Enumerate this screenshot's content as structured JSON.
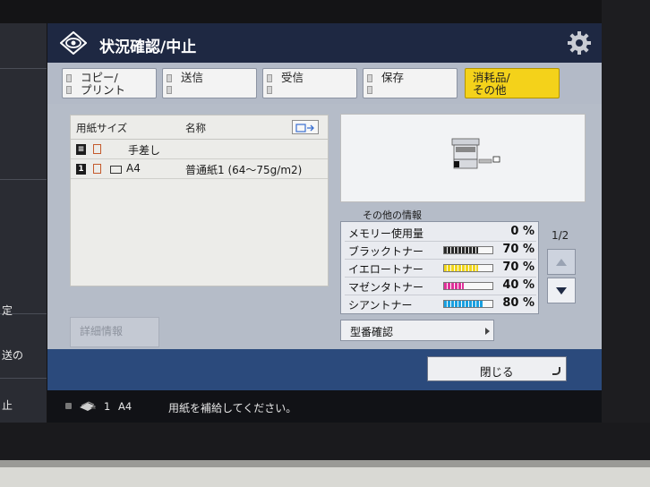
{
  "header": {
    "title": "状況確認/中止",
    "logo_icon": "eye-diamond-icon",
    "settings_icon": "gear-icon"
  },
  "tabs": [
    {
      "label": "コピー/\nプリント",
      "active": false
    },
    {
      "label": "送信",
      "active": false
    },
    {
      "label": "受信",
      "active": false
    },
    {
      "label": "保存",
      "active": false
    },
    {
      "label": "消耗品/\nその他",
      "active": true
    }
  ],
  "paper": {
    "columns": {
      "size": "用紙サイズ",
      "name": "名称"
    },
    "rows": [
      {
        "slot": "",
        "size": "",
        "name": "手差し"
      },
      {
        "slot": "1",
        "size": "A4",
        "name": "普通紙1 (64〜75g/m2)"
      }
    ]
  },
  "detail_button": "詳細情報",
  "other_info": {
    "label": "その他の情報",
    "rows": [
      {
        "label": "メモリー使用量",
        "percent": "0 %",
        "color": "",
        "level": 0
      },
      {
        "label": "ブラックトナー",
        "percent": "70 %",
        "color": "#2a2a2a",
        "level": 70
      },
      {
        "label": "イエロートナー",
        "percent": "70 %",
        "color": "#f0d61c",
        "level": 70
      },
      {
        "label": "マゼンタトナー",
        "percent": "40 %",
        "color": "#e0309a",
        "level": 40
      },
      {
        "label": "シアントナー",
        "percent": "80 %",
        "color": "#1aa0e0",
        "level": 80
      }
    ],
    "page": "1/2"
  },
  "model_button": "型番確認",
  "close_button": "閉じる",
  "status": {
    "tray": "1",
    "size": "A4",
    "message": "用紙を補給してください。"
  },
  "left_panel": {
    "frag1": "定",
    "frag2": "送の",
    "frag3": "止"
  }
}
